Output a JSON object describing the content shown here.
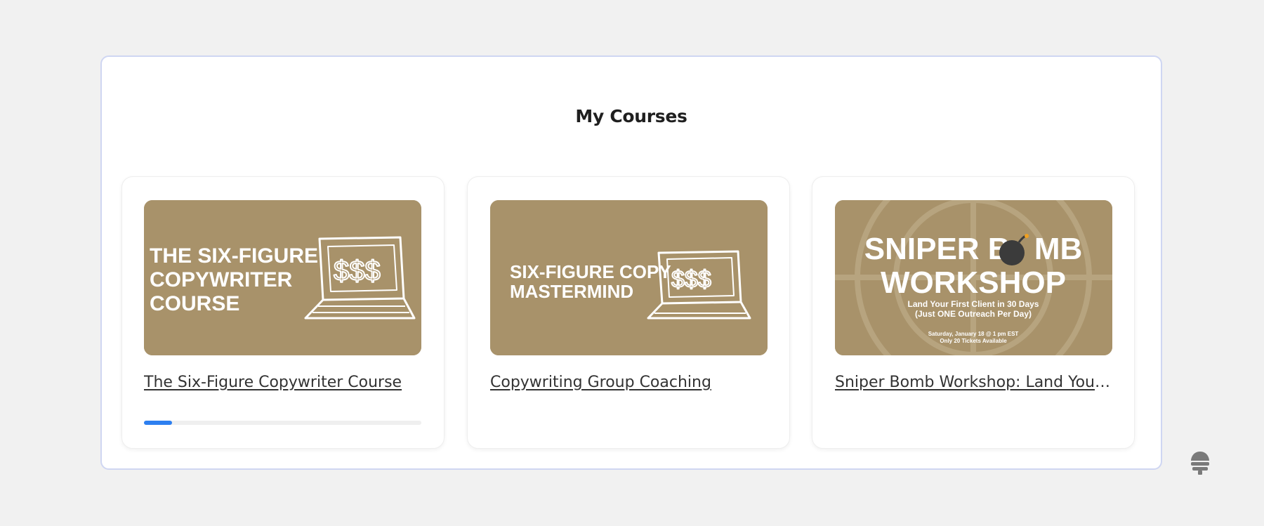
{
  "page_title": "My Courses",
  "colors": {
    "thumbnail_bg": "#a8926a",
    "progress_fill": "#2d7ff0",
    "panel_border": "#cfd6f2"
  },
  "courses": [
    {
      "title": "The Six-Figure Copywriter Course",
      "thumbnail_text": [
        "THE SIX-FIGURE",
        "COPYWRITER",
        "COURSE"
      ],
      "progress_percent": 10
    },
    {
      "title": "Copywriting Group Coaching",
      "thumbnail_text": [
        "SIX-FIGURE COPY",
        "MASTERMIND"
      ]
    },
    {
      "title": "Sniper Bomb Workshop: Land Your ...",
      "thumbnail_text": {
        "headline_1": "SNIPER B",
        "headline_1b": "MB",
        "headline_2": "WORKSHOP",
        "sub_1": "Land Your First Client in 30 Days",
        "sub_2": "(Just ONE Outreach Per Day)",
        "detail_1": "Saturday, January 18 @ 1 pm EST",
        "detail_2": "Only 20 Tickets Available"
      }
    }
  ],
  "help_icon": "beehive-icon"
}
